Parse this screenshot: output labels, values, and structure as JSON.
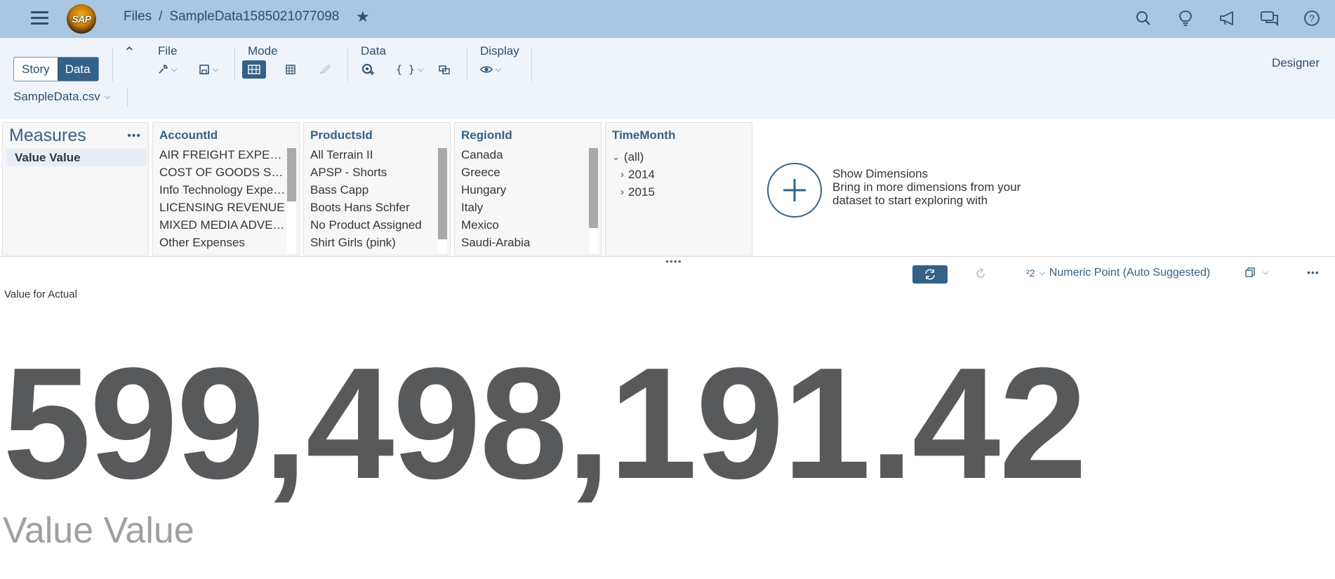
{
  "shell": {
    "logo_text": "SAP",
    "breadcrumb_root": "Files",
    "breadcrumb_sep": "/",
    "story_name": "SampleData1585021077098",
    "icons": [
      "search-icon",
      "lightbulb-icon",
      "megaphone-icon",
      "chat-icon",
      "help-icon"
    ]
  },
  "toolbar": {
    "view_toggle": {
      "story": "Story",
      "data": "Data",
      "selected": "Data"
    },
    "groups": {
      "file": "File",
      "mode": "Mode",
      "data": "Data",
      "display": "Display"
    },
    "designer": "Designer",
    "dataset": "SampleData.csv"
  },
  "panel": {
    "measures": {
      "title": "Measures",
      "items": [
        "Value Value"
      ]
    },
    "account": {
      "title": "AccountId",
      "items": [
        "AIR FREIGHT EXPENSES",
        "COST OF GOODS SOLD",
        "Info Technology Expenses",
        "LICENSING REVENUE",
        "MIXED MEDIA ADVERTISING",
        "Other Expenses"
      ]
    },
    "products": {
      "title": "ProductsId",
      "items": [
        "All Terrain II",
        "APSP - Shorts",
        "Bass Capp",
        "Boots Hans Schfer",
        "No Product Assigned",
        "Shirt Girls (pink)"
      ]
    },
    "region": {
      "title": "RegionId",
      "items": [
        "Canada",
        "Greece",
        "Hungary",
        "Italy",
        "Mexico",
        "Saudi-Arabia"
      ]
    },
    "time": {
      "title": "TimeMonth",
      "root": "(all)",
      "children": [
        "2014",
        "2015"
      ]
    },
    "show_dimensions": {
      "title": "Show Dimensions",
      "desc": "Bring in more dimensions from your dataset to start exploring with"
    }
  },
  "chart": {
    "type_label": "Numeric Point (Auto Suggested)",
    "title": "Value for Actual",
    "value": "599,498,191.42",
    "measure_label": "Value Value"
  },
  "colors": {
    "shell": "#a9c6e2",
    "accent": "#346187",
    "toolbar": "#eef4fa"
  }
}
